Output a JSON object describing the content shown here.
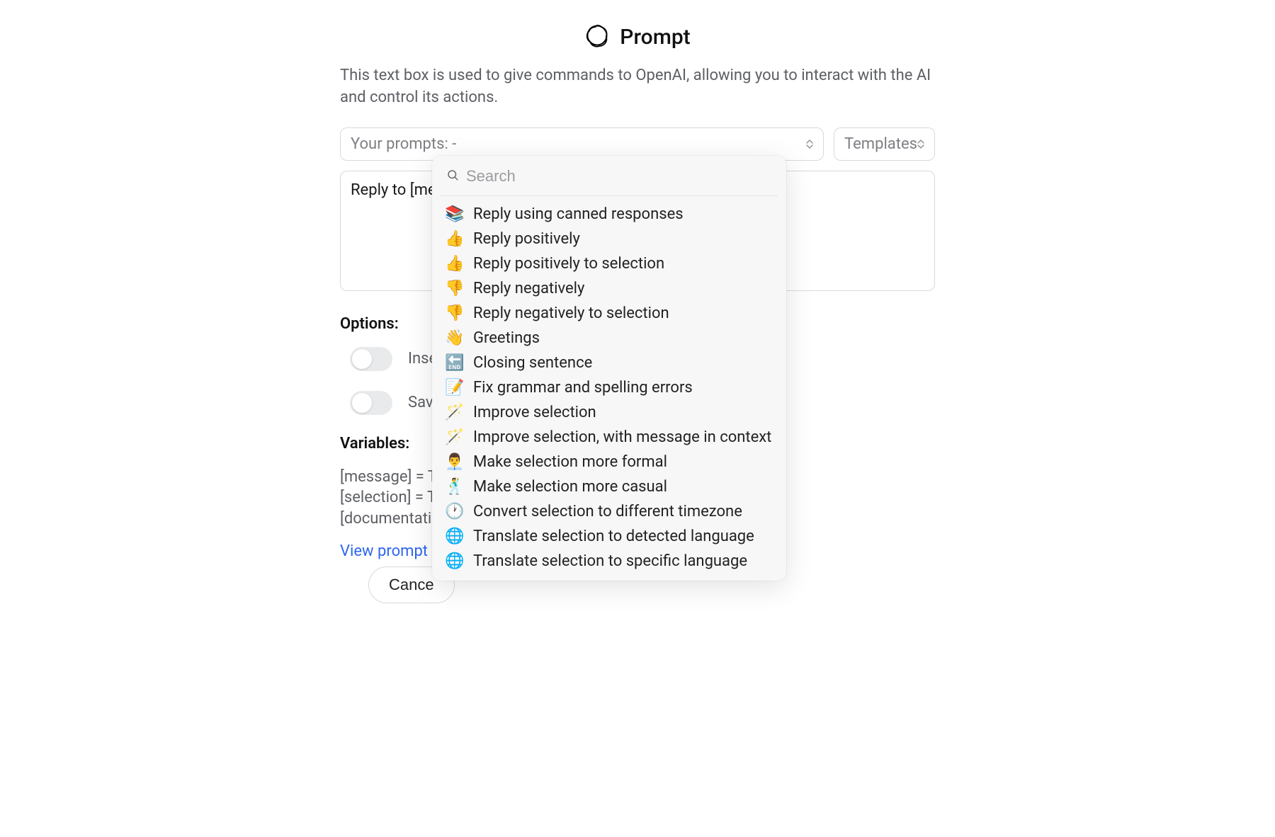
{
  "header": {
    "title": "Prompt"
  },
  "description": "This text box is used to give commands to OpenAI, allowing you to interact with the AI and control its actions.",
  "selects": {
    "prompts_label": "Your prompts: -",
    "templates_label": "Templates"
  },
  "textarea": {
    "value": "Reply to [message]"
  },
  "options": {
    "title": "Options:",
    "insert_newline_label": "Insert answer on a new line",
    "save_prompt_label": "Save prompt for future use"
  },
  "variables": {
    "title": "Variables:",
    "lines": [
      "[message] = The body of the message",
      "[selection] = The text you have selecte",
      "[documentation] = Canned responses"
    ]
  },
  "link_label": "View prompt examples",
  "cancel_label": "Cance",
  "dropdown": {
    "search_placeholder": "Search",
    "items": [
      {
        "emoji": "📚",
        "label": "Reply using canned responses"
      },
      {
        "emoji": "👍",
        "label": "Reply positively"
      },
      {
        "emoji": "👍",
        "label": "Reply positively to selection"
      },
      {
        "emoji": "👎",
        "label": "Reply negatively"
      },
      {
        "emoji": "👎",
        "label": "Reply negatively to selection"
      },
      {
        "emoji": "👋",
        "label": "Greetings"
      },
      {
        "emoji": "🔚",
        "label": "Closing sentence"
      },
      {
        "emoji": "📝",
        "label": "Fix grammar and spelling errors"
      },
      {
        "emoji": "🪄",
        "label": "Improve selection"
      },
      {
        "emoji": "🪄",
        "label": "Improve selection, with message in context"
      },
      {
        "emoji": "👨‍💼",
        "label": "Make selection more formal"
      },
      {
        "emoji": "🕺",
        "label": "Make selection more casual"
      },
      {
        "emoji": "🕐",
        "label": "Convert selection to different timezone"
      },
      {
        "emoji": "🌐",
        "label": "Translate selection to detected language"
      },
      {
        "emoji": "🌐",
        "label": "Translate selection to specific language"
      }
    ]
  }
}
